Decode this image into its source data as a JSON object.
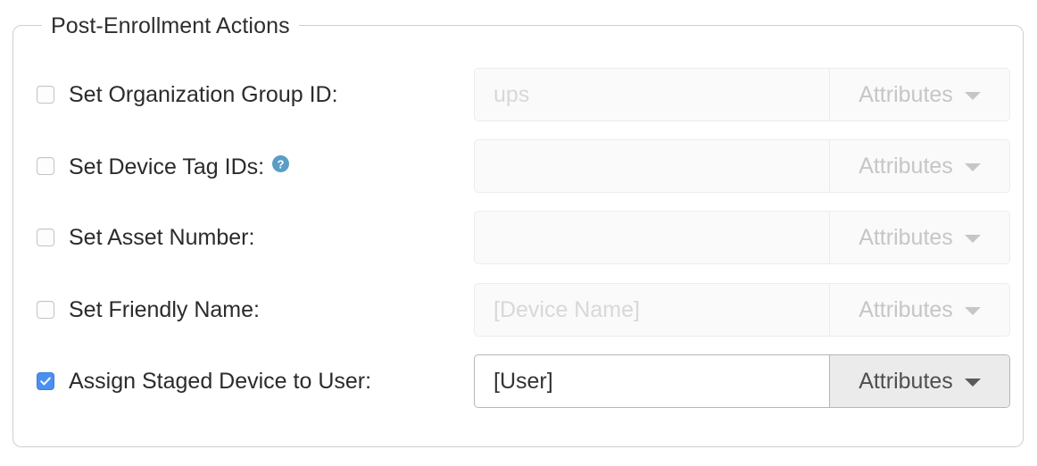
{
  "panel": {
    "legend": "Post-Enrollment Actions"
  },
  "rows": [
    {
      "label": "Set Organization Group ID:",
      "checked": false,
      "enabled": false,
      "has_help_icon": false,
      "help_icon": "help-circle-icon",
      "input_value": "",
      "input_placeholder": "ups",
      "button_label": "Attributes",
      "caret_icon": "chevron-down-icon"
    },
    {
      "label": "Set Device Tag IDs:",
      "checked": false,
      "enabled": false,
      "has_help_icon": true,
      "help_icon": "help-circle-icon",
      "input_value": "",
      "input_placeholder": "",
      "button_label": "Attributes",
      "caret_icon": "chevron-down-icon"
    },
    {
      "label": "Set Asset Number:",
      "checked": false,
      "enabled": false,
      "has_help_icon": false,
      "help_icon": "help-circle-icon",
      "input_value": "",
      "input_placeholder": "",
      "button_label": "Attributes",
      "caret_icon": "chevron-down-icon"
    },
    {
      "label": "Set Friendly Name:",
      "checked": false,
      "enabled": false,
      "has_help_icon": false,
      "help_icon": "help-circle-icon",
      "input_value": "",
      "input_placeholder": "[Device Name]",
      "button_label": "Attributes",
      "caret_icon": "chevron-down-icon"
    },
    {
      "label": "Assign Staged Device to User:",
      "checked": true,
      "enabled": true,
      "has_help_icon": false,
      "help_icon": "help-circle-icon",
      "input_value": "[User]",
      "input_placeholder": "",
      "button_label": "Attributes",
      "caret_icon": "chevron-down-icon"
    }
  ],
  "colors": {
    "checkbox_checked": "#4a90f0",
    "help_icon": "#5b9dc4",
    "panel_border": "#cfcfcf",
    "label_text": "#2b2b2b",
    "disabled_text": "#c6c6c6"
  }
}
